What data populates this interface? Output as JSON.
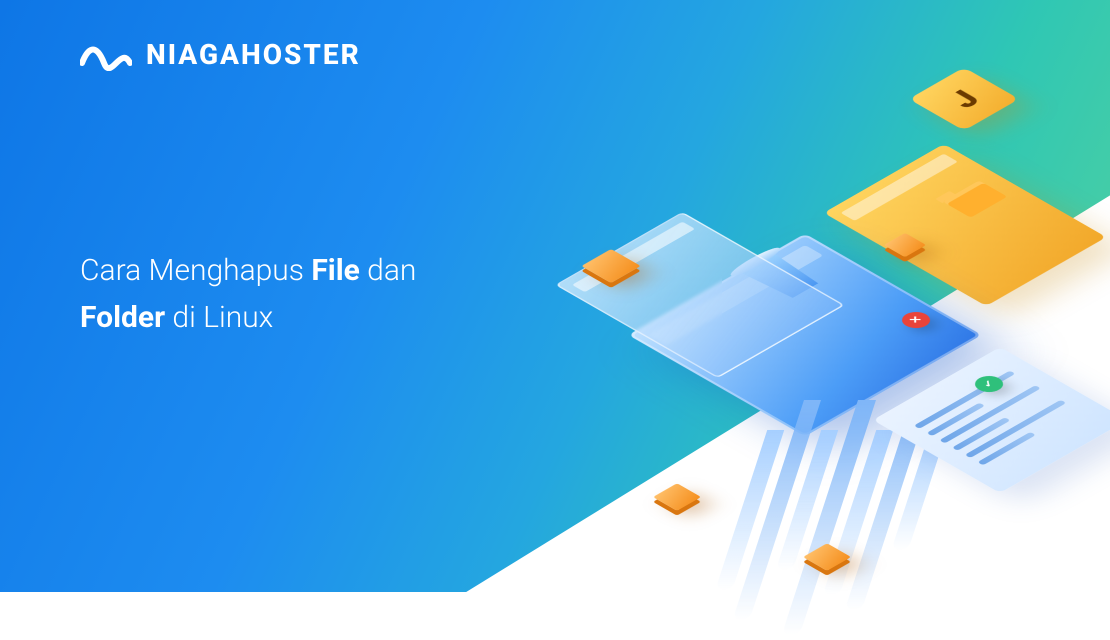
{
  "brand": {
    "name": "NIAGAHOSTER"
  },
  "headline": {
    "p1": "Cara Menghapus ",
    "b1": "File",
    "p2": " dan ",
    "b2": "Folder",
    "p3": " di Linux"
  },
  "illustration": {
    "j_tile_glyph": "J",
    "status_ok": "check",
    "status_fail": "cross"
  },
  "colors": {
    "grad_from": "#0E76E6",
    "grad_to": "#5AD39A",
    "accent_yellow": "#F4AE2E",
    "accent_orange": "#F58F1E",
    "ok": "#2FC07B",
    "fail": "#E9443A"
  }
}
